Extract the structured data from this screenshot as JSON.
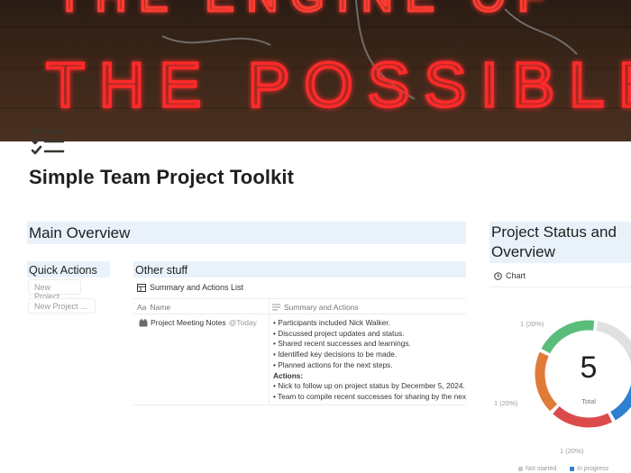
{
  "cover": {
    "sign_line_top": "THE ENGINE OF",
    "sign_line_main": "THE POSSIBLE"
  },
  "page": {
    "icon": "checklist-icon",
    "title": "Simple Team Project Toolkit"
  },
  "main_overview": {
    "title": "Main Overview"
  },
  "status_overview": {
    "title_line1": "Project Status and",
    "title_line2": "Overview"
  },
  "quick_actions": {
    "title": "Quick Actions",
    "buttons": [
      "New Project",
      "New Project ..."
    ]
  },
  "other_stuff": {
    "title": "Other stuff",
    "view_icon": "table-icon",
    "view_title": "Summary and Actions List",
    "columns": [
      {
        "icon": "text-icon",
        "label": "Aa",
        "name": "Name"
      },
      {
        "icon": "lines-icon",
        "name": "Summary and Actions"
      }
    ],
    "rows": [
      {
        "name": "Project Meeting Notes",
        "date": "@Today",
        "summary": [
          "• Participants included Nick Walker.",
          "• Discussed project updates and status.",
          "• Shared recent successes and learnings.",
          "• Identified key decisions to be made.",
          "• Planned actions for the next steps."
        ],
        "actions_label": "Actions:",
        "actions": [
          "• Nick to follow up on project status by December 5, 2024.",
          "• Team to compile recent successes for sharing by the next meeting."
        ]
      }
    ]
  },
  "chart_tab": {
    "icon": "clock-icon",
    "label": "Chart"
  },
  "chart_data": {
    "type": "pie",
    "center_value": "5",
    "center_label": "Total",
    "slice_labels": [
      "1 (20%)",
      "1 (20%)",
      "1 (20%)"
    ],
    "values": [
      1,
      1,
      1,
      1,
      1
    ],
    "colors": [
      "#e0e0e0",
      "#2f80d1",
      "#dc4b4b",
      "#e07b39",
      "#5bbd7a"
    ],
    "legend": [
      "Not started",
      "In progress"
    ],
    "legend_colors": [
      "#c9c9c9",
      "#2f80d1"
    ]
  }
}
